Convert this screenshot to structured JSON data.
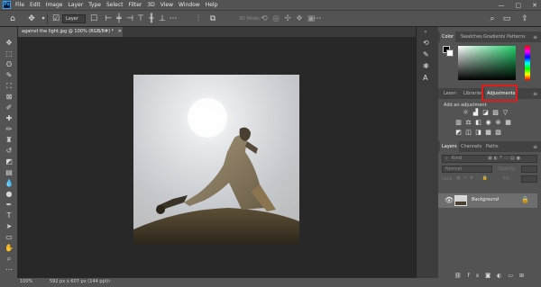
{
  "menu": {
    "logo": "Ps",
    "items": [
      "File",
      "Edit",
      "Image",
      "Layer",
      "Type",
      "Select",
      "Filter",
      "3D",
      "View",
      "Window",
      "Help"
    ]
  },
  "window_controls": [
    "—",
    "▢",
    "✕"
  ],
  "options": {
    "layer_select": "Layer",
    "mode3d": "3D Mode:"
  },
  "document": {
    "tab_title": "against the light.jpg @ 100% (RGB/8#) *"
  },
  "status": {
    "zoom": "100%",
    "dimensions": "592 px x 607 px (144 ppi)"
  },
  "color_panel": {
    "tabs": [
      "Color",
      "Swatches",
      "Gradients",
      "Patterns"
    ],
    "active": "Color"
  },
  "adjust_panel": {
    "tabs": [
      "Learn",
      "Libraries",
      "Adjustments"
    ],
    "active": "Adjustments",
    "hint": "Add an adjustment",
    "highlight_color": "#e01c1c"
  },
  "layers_panel": {
    "tabs": [
      "Layers",
      "Channels",
      "Paths"
    ],
    "active": "Layers",
    "filter_placeholder": "Kind",
    "blend_mode": "Normal",
    "opacity_label": "Opacity:",
    "lock_label": "Lock:",
    "fill_label": "Fill:",
    "layers": [
      {
        "name": "Background",
        "visible": true,
        "locked": true
      }
    ]
  },
  "colors": {
    "menubar": "#535353",
    "canvas": "#282828",
    "panel": "#535353",
    "selected_layer": "#6e6e6e"
  }
}
